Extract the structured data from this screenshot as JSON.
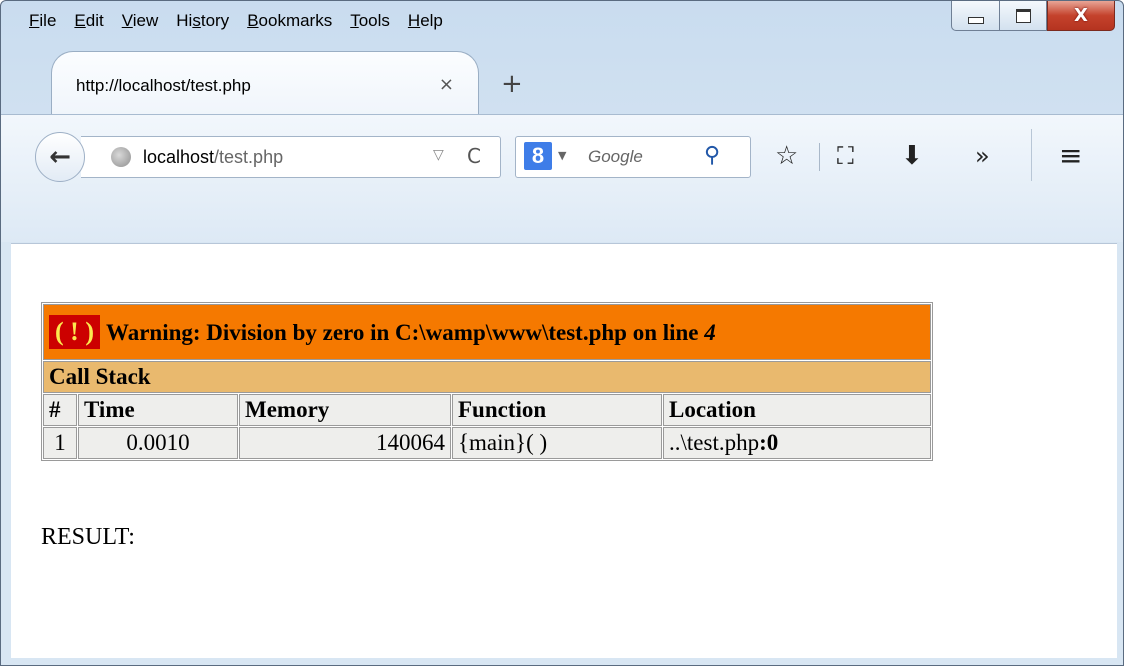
{
  "menubar": {
    "items": [
      {
        "prefix": "",
        "underline": "F",
        "rest": "ile"
      },
      {
        "prefix": "",
        "underline": "E",
        "rest": "dit"
      },
      {
        "prefix": "",
        "underline": "V",
        "rest": "iew"
      },
      {
        "prefix": "Hi",
        "underline": "s",
        "rest": "tory"
      },
      {
        "prefix": "",
        "underline": "B",
        "rest": "ookmarks"
      },
      {
        "prefix": "",
        "underline": "T",
        "rest": "ools"
      },
      {
        "prefix": "",
        "underline": "H",
        "rest": "elp"
      }
    ]
  },
  "tab": {
    "title": "http://localhost/test.php",
    "close_glyph": "×"
  },
  "newtab_glyph": "+",
  "nav": {
    "back_glyph": "←",
    "url_host": "localhost",
    "url_path": "/test.php",
    "dropmarker_glyph": "▽",
    "reload_glyph": "C",
    "search_engine_glyph": "8",
    "search_dropdown_glyph": "▼",
    "search_placeholder": "Google",
    "search_glyph": "⚲",
    "bookmark_glyph": "☆",
    "reader_glyph": "⛶",
    "download_glyph": "⬇",
    "overflow_glyph": "»",
    "menu_glyph": "≡"
  },
  "window_controls": {
    "minimize": "",
    "maximize": "",
    "close": "X"
  },
  "xdebug": {
    "icon": "( ! )",
    "warning_prefix": "Warning: Division by zero in C:\\wamp\\www\\test.php on line ",
    "warning_line": "4",
    "call_stack_label": "Call Stack",
    "headers": [
      "#",
      "Time",
      "Memory",
      "Function",
      "Location"
    ],
    "row": {
      "num": "1",
      "time": "0.0010",
      "memory": "140064",
      "function": "{main}( )",
      "location_prefix": "..\\test.php",
      "location_line": ":0"
    }
  },
  "result_text": "RESULT:",
  "colors": {
    "warning_bg": "#f57900",
    "callstack_bg": "#e9b96e",
    "cell_bg": "#eeeeec",
    "icon_bg": "#cc0000",
    "icon_fg": "#fce94f"
  }
}
